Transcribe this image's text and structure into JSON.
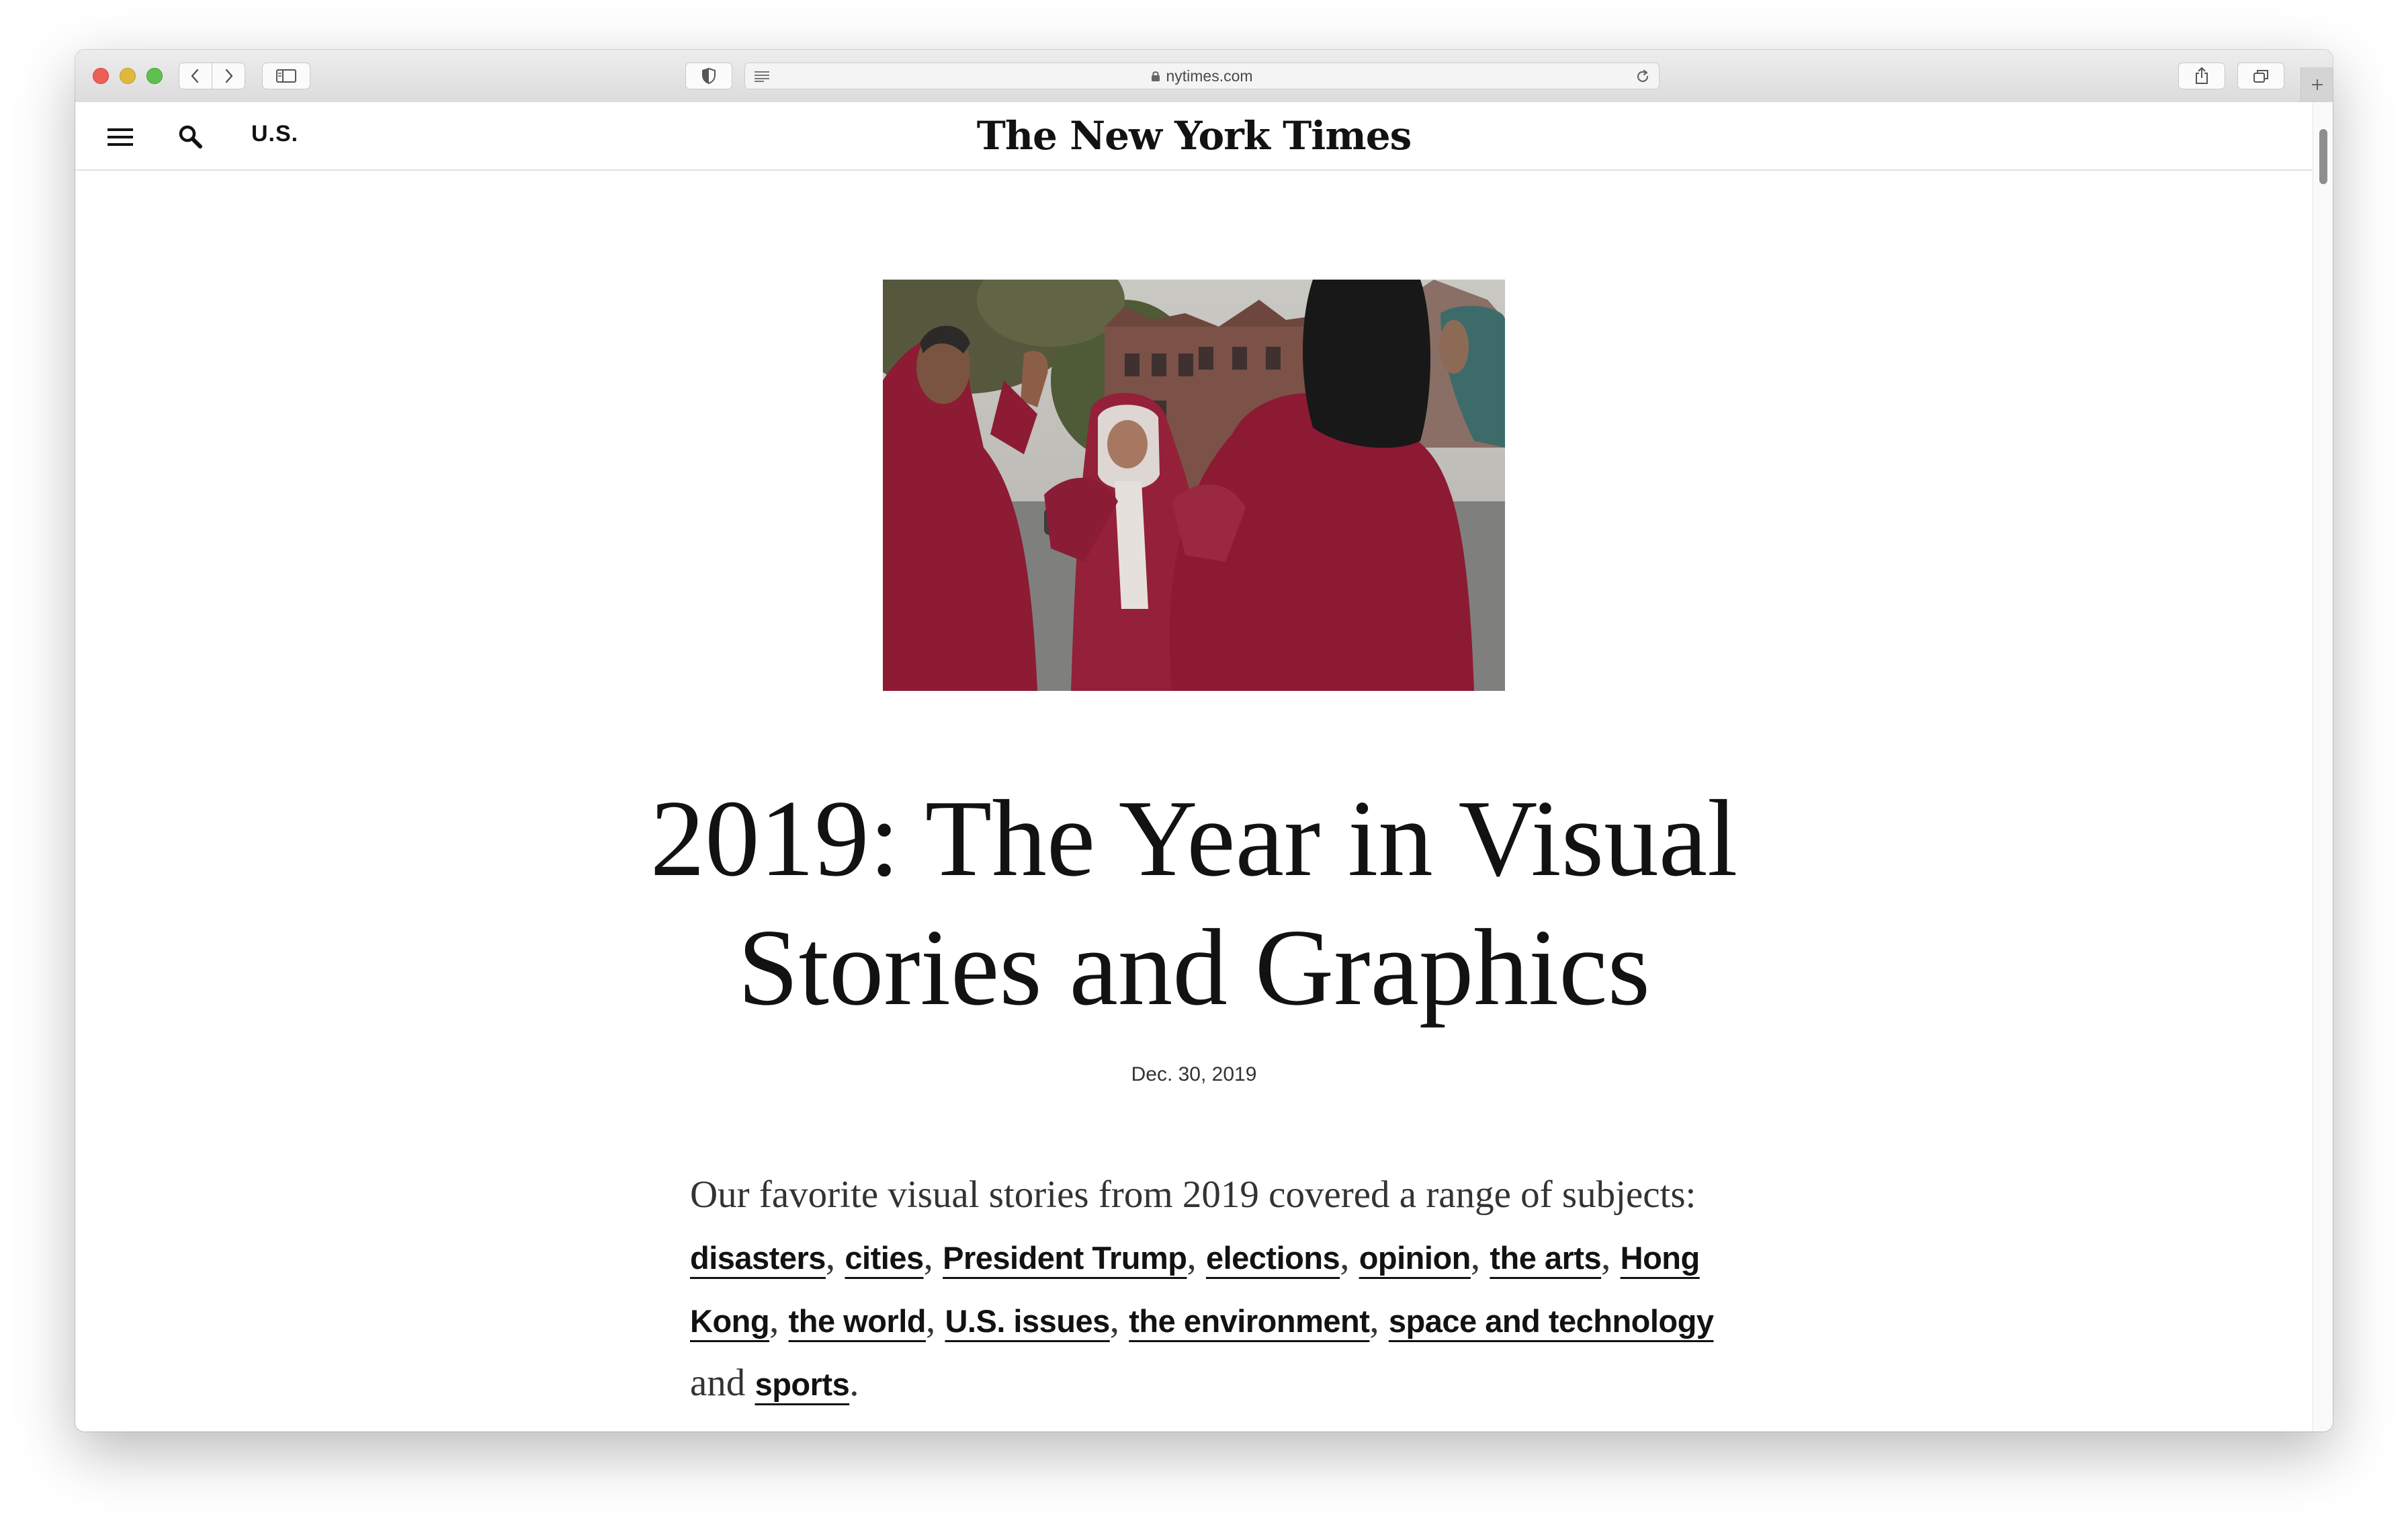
{
  "browser": {
    "url": "nytimes.com"
  },
  "header": {
    "section": "U.S.",
    "masthead": "The New York Times"
  },
  "article": {
    "headline": "2019: The Year in Visual Stories and Graphics",
    "date": "Dec. 30, 2019",
    "summary_intro": "Our favorite visual stories from 2019 covered a range of subjects:",
    "topics": [
      "disasters",
      "cities",
      "President Trump",
      "elections",
      "opinion",
      "the arts",
      "Hong Kong",
      "the world",
      "U.S. issues",
      "the environment",
      "space and technology",
      "sports"
    ],
    "separator": ",",
    "conjunction": "and",
    "end": "."
  },
  "colors": {
    "text": "#121212",
    "toolbar": "#dcdcdc",
    "hoodie": "#8b1a34"
  }
}
